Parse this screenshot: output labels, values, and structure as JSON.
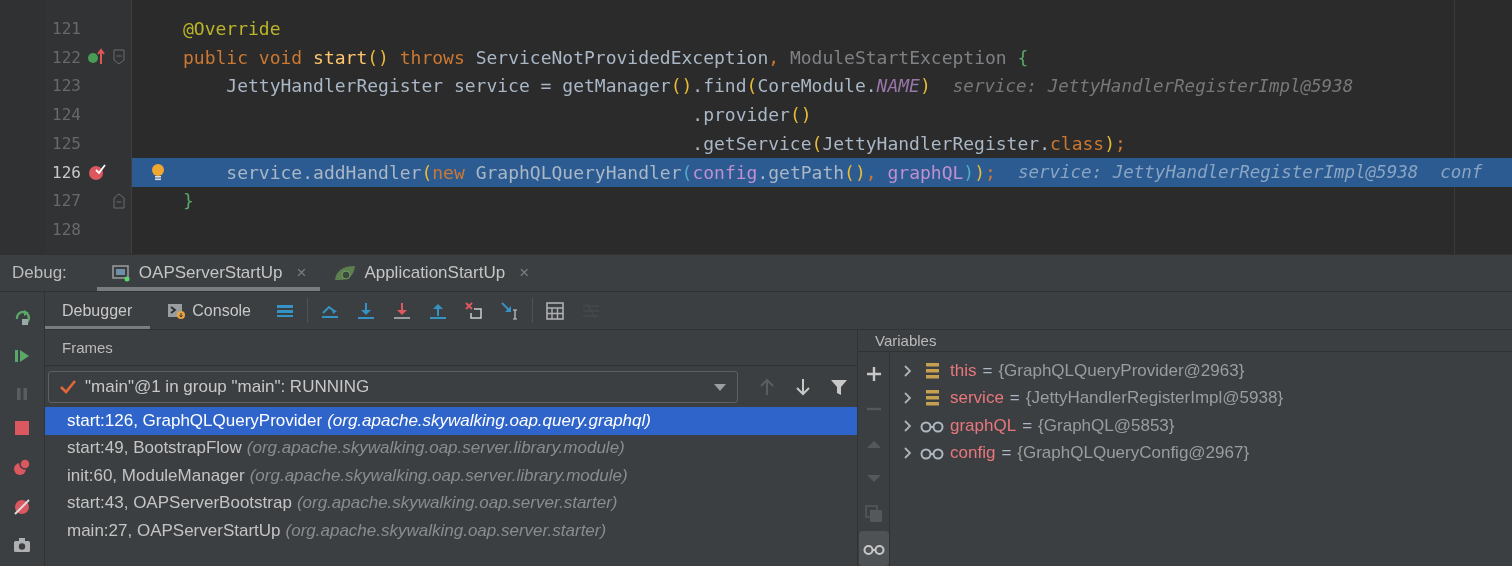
{
  "editor": {
    "lines": [
      {
        "number": "121",
        "selected": false,
        "overrides": false,
        "breakpoint": false,
        "fold_start": false,
        "fold_end": false,
        "intention": false,
        "tokens": [
          {
            "kind": "annotation",
            "text": "@Override"
          }
        ]
      },
      {
        "number": "122",
        "selected": false,
        "overrides": true,
        "breakpoint": false,
        "fold_start": true,
        "fold_end": false,
        "intention": false,
        "tokens": [
          {
            "kind": "keyword",
            "text": "public void "
          },
          {
            "kind": "decl",
            "text": "start"
          },
          {
            "kind": "bracket",
            "text": "()"
          },
          {
            "kind": "keyword",
            "text": " throws "
          },
          {
            "kind": "plain",
            "text": "ServiceNotProvidedException"
          },
          {
            "kind": "keyword",
            "text": ", "
          },
          {
            "kind": "muted",
            "text": "ModuleStartException"
          },
          {
            "kind": "bracket3",
            "text": " {"
          }
        ]
      },
      {
        "number": "123",
        "selected": false,
        "overrides": false,
        "breakpoint": false,
        "fold_start": false,
        "fold_end": false,
        "intention": false,
        "tokens": [
          {
            "kind": "plain",
            "text": "    JettyHandlerRegister service = getManager"
          },
          {
            "kind": "bracket",
            "text": "()"
          },
          {
            "kind": "plain",
            "text": ".find"
          },
          {
            "kind": "bracket",
            "text": "("
          },
          {
            "kind": "plain",
            "text": "CoreModule."
          },
          {
            "kind": "constant",
            "text": "NAME"
          },
          {
            "kind": "bracket",
            "text": ")"
          }
        ],
        "hints": [
          "service: JettyHandlerRegisterImpl@5938"
        ]
      },
      {
        "number": "124",
        "selected": false,
        "overrides": false,
        "breakpoint": false,
        "fold_start": false,
        "fold_end": false,
        "intention": false,
        "tokens": [
          {
            "kind": "plain",
            "text": "                                               .provider"
          },
          {
            "kind": "bracket",
            "text": "()"
          }
        ]
      },
      {
        "number": "125",
        "selected": false,
        "overrides": false,
        "breakpoint": false,
        "fold_start": false,
        "fold_end": false,
        "intention": false,
        "tokens": [
          {
            "kind": "plain",
            "text": "                                               .getService"
          },
          {
            "kind": "bracket",
            "text": "("
          },
          {
            "kind": "plain",
            "text": "JettyHandlerRegister."
          },
          {
            "kind": "keyword",
            "text": "class"
          },
          {
            "kind": "bracket",
            "text": ")"
          },
          {
            "kind": "keyword",
            "text": ";"
          }
        ]
      },
      {
        "number": "126",
        "selected": true,
        "overrides": false,
        "breakpoint": true,
        "fold_start": false,
        "fold_end": false,
        "intention": true,
        "tokens": [
          {
            "kind": "plain",
            "text": "    service.addHandler"
          },
          {
            "kind": "bracket",
            "text": "("
          },
          {
            "kind": "keyword",
            "text": "new "
          },
          {
            "kind": "plain",
            "text": "GraphQLQueryHandler"
          },
          {
            "kind": "bracket2",
            "text": "("
          },
          {
            "kind": "param",
            "text": "config"
          },
          {
            "kind": "plain",
            "text": ".getPath"
          },
          {
            "kind": "bracket",
            "text": "()"
          },
          {
            "kind": "keyword",
            "text": ", "
          },
          {
            "kind": "param",
            "text": "graphQL"
          },
          {
            "kind": "bracket2",
            "text": ")"
          },
          {
            "kind": "bracket",
            "text": ")"
          },
          {
            "kind": "keyword",
            "text": ";"
          }
        ],
        "hints": [
          "service: JettyHandlerRegisterImpl@5938",
          "conf"
        ]
      },
      {
        "number": "127",
        "selected": false,
        "overrides": false,
        "breakpoint": false,
        "fold_start": false,
        "fold_end": true,
        "intention": false,
        "tokens": [
          {
            "kind": "bracket3",
            "text": "}"
          }
        ]
      },
      {
        "number": "128",
        "selected": false,
        "overrides": false,
        "breakpoint": false,
        "fold_start": false,
        "fold_end": false,
        "intention": false
      }
    ]
  },
  "debug": {
    "label": "Debug:",
    "sessions": [
      {
        "name": "OAPServerStartUp",
        "kind": "app",
        "selected": true,
        "close": "×"
      },
      {
        "name": "ApplicationStartUp",
        "kind": "spring",
        "selected": false,
        "close": "×"
      }
    ],
    "side_tools": [
      {
        "kind": "rerun"
      },
      {
        "kind": "resume"
      },
      {
        "kind": "pause",
        "disabled": true
      },
      {
        "kind": "stop"
      },
      {
        "kind": "breakpoints"
      },
      {
        "kind": "mute"
      },
      {
        "kind": "camera"
      }
    ],
    "tabs": [
      {
        "label": "Debugger",
        "kind": "plain",
        "selected": true
      },
      {
        "label": "Console",
        "kind": "console",
        "selected": false
      }
    ],
    "toolbar": [
      {
        "kind": "menu",
        "disabled": false
      },
      {
        "kind": "step-over",
        "disabled": false
      },
      {
        "kind": "step-into",
        "disabled": false
      },
      {
        "kind": "force-step-into",
        "disabled": false
      },
      {
        "kind": "step-out",
        "disabled": false
      },
      {
        "kind": "drop-frame",
        "disabled": false
      },
      {
        "kind": "run-to-cursor",
        "disabled": false
      },
      {
        "kind": "evaluate",
        "disabled": false
      },
      {
        "kind": "trace",
        "disabled": true
      }
    ]
  },
  "frames": {
    "title": "Frames",
    "thread": "\"main\"@1 in group \"main\": RUNNING",
    "tools": [
      {
        "kind": "up",
        "disabled": true
      },
      {
        "kind": "down",
        "disabled": false
      },
      {
        "kind": "filter",
        "disabled": false
      }
    ],
    "items": [
      {
        "method": "start:126, GraphQLQueryProvider",
        "package": "(org.apache.skywalking.oap.query.graphql)",
        "selected": true
      },
      {
        "method": "start:49, BootstrapFlow",
        "package": "(org.apache.skywalking.oap.server.library.module)",
        "selected": false
      },
      {
        "method": "init:60, ModuleManager",
        "package": "(org.apache.skywalking.oap.server.library.module)",
        "selected": false
      },
      {
        "method": "start:43, OAPServerBootstrap",
        "package": "(org.apache.skywalking.oap.server.starter)",
        "selected": false
      },
      {
        "method": "main:27, OAPServerStartUp",
        "package": "(org.apache.skywalking.oap.server.starter)",
        "selected": false
      }
    ]
  },
  "variables": {
    "title": "Variables",
    "tools": [
      {
        "kind": "add",
        "disabled": false
      },
      {
        "kind": "remove",
        "disabled": true
      },
      {
        "kind": "up",
        "disabled": true
      },
      {
        "kind": "down",
        "disabled": true
      },
      {
        "kind": "copy",
        "disabled": true
      },
      {
        "kind": "watches",
        "disabled": false
      }
    ],
    "items": [
      {
        "kind": "field",
        "name": "this",
        "operator": "=",
        "value": "{GraphQLQueryProvider@2963}"
      },
      {
        "kind": "field",
        "name": "service",
        "operator": "=",
        "value": "{JettyHandlerRegisterImpl@5938}"
      },
      {
        "kind": "watch",
        "name": "graphQL",
        "operator": "=",
        "value": "{GraphQL@5853}"
      },
      {
        "kind": "watch",
        "name": "config",
        "operator": "=",
        "value": "{GraphQLQueryConfig@2967}"
      }
    ]
  }
}
